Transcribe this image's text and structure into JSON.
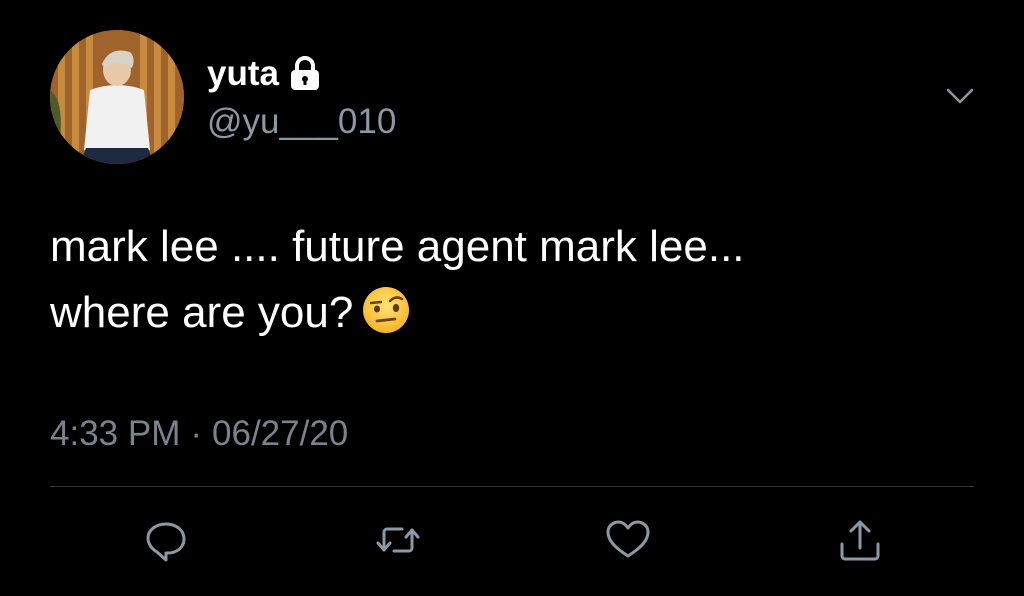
{
  "tweet": {
    "display_name": "yuta",
    "handle": "@yu___010",
    "text_line1": "mark lee .... future agent mark lee...",
    "text_line2": "where are you?",
    "emoji": "face-with-raised-eyebrow",
    "time": "4:33 PM",
    "separator": "·",
    "date": "06/27/20",
    "protected": true
  },
  "icons": {
    "lock": "lock-icon",
    "more": "chevron-down-icon",
    "reply": "reply-icon",
    "retweet": "retweet-icon",
    "like": "heart-icon",
    "share": "share-icon"
  },
  "colors": {
    "background": "#000000",
    "primary_text": "#ffffff",
    "secondary_text": "#8b98a5",
    "timestamp_text": "#7a838d",
    "divider": "#2f3336",
    "icon": "#8b98a5"
  }
}
